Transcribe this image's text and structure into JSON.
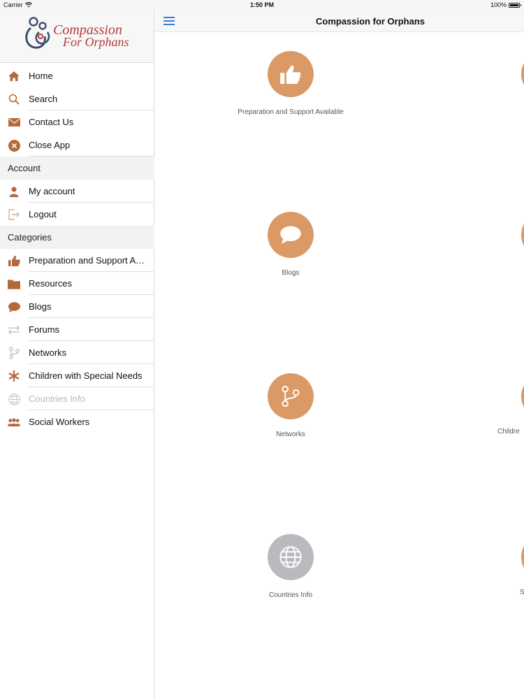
{
  "status_bar": {
    "carrier": "Carrier",
    "time": "1:50 PM",
    "battery": "100%",
    "battery_level": 1.0
  },
  "logo": {
    "line1": "Compassion",
    "line2": "For Orphans"
  },
  "nav": {
    "title": "Compassion for Orphans"
  },
  "menu": {
    "main": [
      {
        "label": "Home",
        "icon": "home-icon"
      },
      {
        "label": "Search",
        "icon": "search-icon"
      },
      {
        "label": "Contact Us",
        "icon": "envelope-icon"
      },
      {
        "label": "Close App",
        "icon": "close-circle-icon"
      }
    ],
    "account_header": "Account",
    "account": [
      {
        "label": "My account",
        "icon": "user-icon"
      },
      {
        "label": "Logout",
        "icon": "logout-icon"
      }
    ],
    "categories_header": "Categories",
    "categories": [
      {
        "label": "Preparation and Support Available",
        "icon": "thumbs-up-icon"
      },
      {
        "label": "Resources",
        "icon": "folder-icon"
      },
      {
        "label": "Blogs",
        "icon": "chat-bubble-icon"
      },
      {
        "label": "Forums",
        "icon": "arrows-exchange-icon"
      },
      {
        "label": "Networks",
        "icon": "branch-icon"
      },
      {
        "label": "Children with Special Needs",
        "icon": "asterisk-icon"
      },
      {
        "label": "Countries Info",
        "icon": "globe-icon"
      },
      {
        "label": "Social Workers",
        "icon": "group-icon"
      }
    ]
  },
  "tiles": [
    {
      "caption": "Preparation and Support Available",
      "icon": "thumbs-up-icon"
    },
    {
      "caption": "Blogs",
      "icon": "chat-bubble-icon"
    },
    {
      "caption": "Networks",
      "icon": "branch-icon"
    },
    {
      "caption": "Countries Info",
      "icon": "globe-icon"
    }
  ],
  "edge_tiles": [
    {
      "caption": ""
    },
    {
      "caption": ""
    },
    {
      "caption": "Childre"
    },
    {
      "caption": "S"
    }
  ],
  "colors": {
    "accent": "#db9a65",
    "icon_brown": "#b5693a",
    "disabled_gray": "#b9b9be",
    "brand_red": "#b83a3a",
    "nav_blue": "#3a7bd5"
  }
}
